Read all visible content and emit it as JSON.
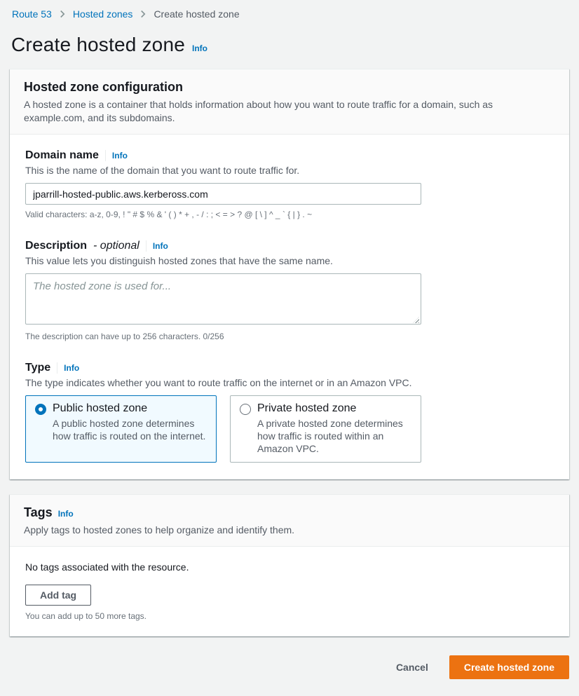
{
  "breadcrumb": {
    "items": [
      {
        "label": "Route 53"
      },
      {
        "label": "Hosted zones"
      },
      {
        "label": "Create hosted zone"
      }
    ]
  },
  "page": {
    "title": "Create hosted zone",
    "info_label": "Info"
  },
  "config_panel": {
    "title": "Hosted zone configuration",
    "description": "A hosted zone is a container that holds information about how you want to route traffic for a domain, such as example.com, and its subdomains.",
    "domain": {
      "label": "Domain name",
      "info_label": "Info",
      "description": "This is the name of the domain that you want to route traffic for.",
      "value": "jparrill-hosted-public.aws.kerbeross.com",
      "constraint": "Valid characters: a-z, 0-9, ! \" # $ % & ' ( ) * + , - / : ; < = > ? @ [ \\ ] ^ _ ` { | } . ~"
    },
    "description_field": {
      "label": "Description",
      "optional_label": "- optional",
      "info_label": "Info",
      "description": "This value lets you distinguish hosted zones that have the same name.",
      "placeholder": "The hosted zone is used for...",
      "constraint": "The description can have up to 256 characters. 0/256"
    },
    "type_field": {
      "label": "Type",
      "info_label": "Info",
      "description": "The type indicates whether you want to route traffic on the internet or in an Amazon VPC.",
      "options": [
        {
          "title": "Public hosted zone",
          "description": "A public hosted zone determines how traffic is routed on the internet.",
          "selected": true
        },
        {
          "title": "Private hosted zone",
          "description": "A private hosted zone determines how traffic is routed within an Amazon VPC.",
          "selected": false
        }
      ]
    }
  },
  "tags_panel": {
    "title": "Tags",
    "info_label": "Info",
    "description": "Apply tags to hosted zones to help organize and identify them.",
    "empty_message": "No tags associated with the resource.",
    "add_button_label": "Add tag",
    "constraint": "You can add up to 50 more tags."
  },
  "footer": {
    "cancel_label": "Cancel",
    "submit_label": "Create hosted zone"
  },
  "colors": {
    "link_blue": "#0073bb",
    "accent_orange": "#ec7211",
    "selected_tile_bg": "#f1faff",
    "page_bg": "#f2f3f3"
  }
}
